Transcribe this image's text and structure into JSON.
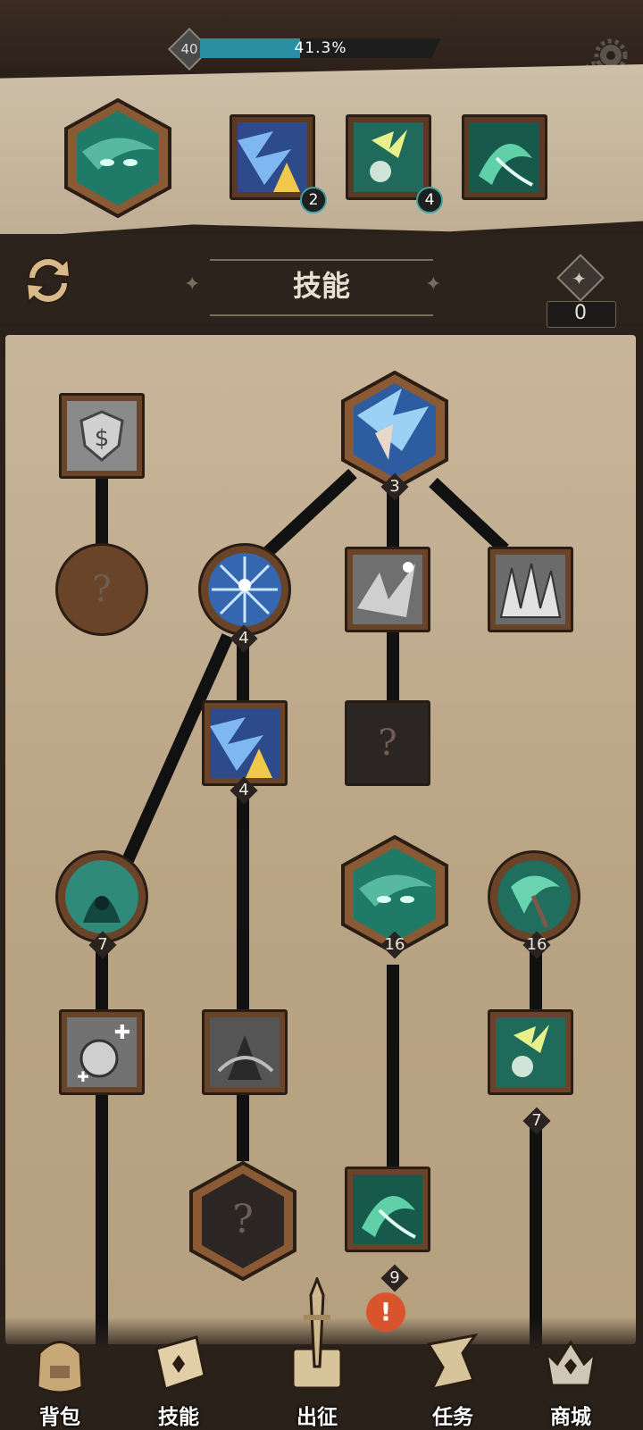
{
  "player": {
    "level": "40",
    "xp_percent": 41.3,
    "xp_label": "41.3%"
  },
  "icons": {
    "settings": "gear-icon",
    "swap": "swap-arrows-icon",
    "skill_point": "skill-point-diamond-icon",
    "unknown": "question-mark-icon",
    "alert": "exclamation-icon"
  },
  "equipped": {
    "slots": [
      {
        "name": "green-spirit-skill",
        "level": null
      },
      {
        "name": "ice-storm-skill",
        "level": "2"
      },
      {
        "name": "green-lightning-skill",
        "level": "4"
      },
      {
        "name": "green-cyclone-skill",
        "level": null
      }
    ]
  },
  "section": {
    "title": "技能",
    "skill_points": "0"
  },
  "tree": {
    "nodes": [
      {
        "id": "shield-buff",
        "level": null,
        "locked": true
      },
      {
        "id": "unknown-1",
        "level": null
      },
      {
        "id": "ice-hero",
        "level": "3"
      },
      {
        "id": "frost-orb",
        "level": "4"
      },
      {
        "id": "shatter",
        "level": null,
        "locked": true
      },
      {
        "id": "ice-spikes",
        "level": null,
        "locked": true
      },
      {
        "id": "ice-storm",
        "level": "4"
      },
      {
        "id": "unknown-2",
        "level": null
      },
      {
        "id": "green-hood",
        "level": "7"
      },
      {
        "id": "green-spirit",
        "level": "16"
      },
      {
        "id": "green-whirl",
        "level": "16"
      },
      {
        "id": "potion-heal",
        "level": null,
        "locked": true
      },
      {
        "id": "dark-warrior",
        "level": null,
        "locked": true
      },
      {
        "id": "green-lightning",
        "level": "7"
      },
      {
        "id": "unknown-3",
        "level": null
      },
      {
        "id": "green-cyclone",
        "level": "9"
      }
    ]
  },
  "nav": {
    "items": [
      {
        "label": "背包"
      },
      {
        "label": "技能"
      },
      {
        "label": "出征"
      },
      {
        "label": "任务"
      },
      {
        "label": "商城"
      }
    ],
    "alert": "!"
  },
  "colors": {
    "xp_fill": "#2a8fa3",
    "badge_ring": "#3fa3a0",
    "parchment": "#c2ae90",
    "frame": "#6a4428",
    "alert": "#d9542c"
  }
}
